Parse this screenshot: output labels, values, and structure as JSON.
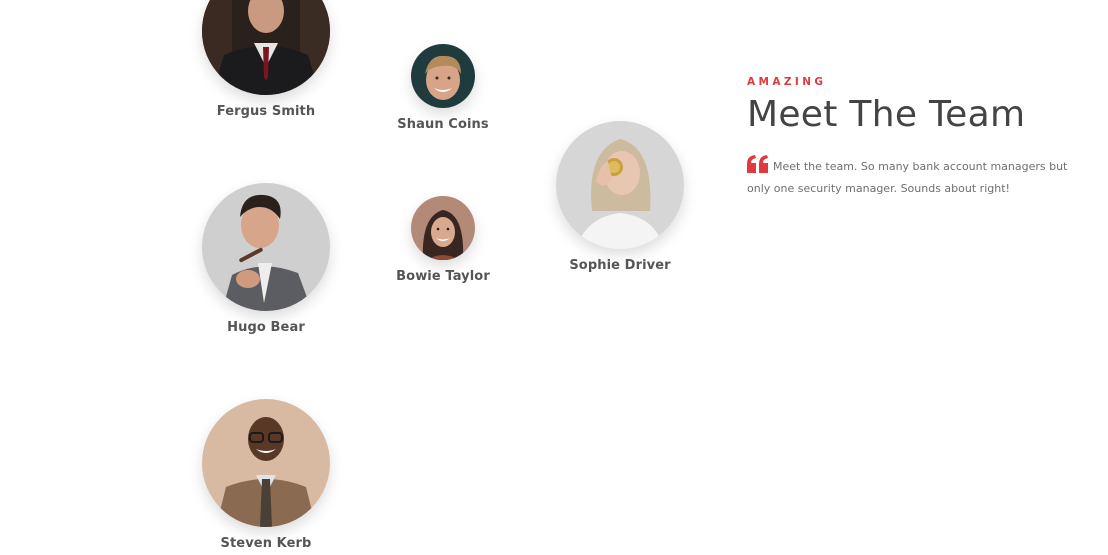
{
  "theme": {
    "accent": "#e0393e",
    "heading_color": "#444444",
    "text_color": "#6f6f6f"
  },
  "team": {
    "members": [
      {
        "name": "Fergus Smith"
      },
      {
        "name": "Shaun Coins"
      },
      {
        "name": "Hugo Bear"
      },
      {
        "name": "Bowie Taylor"
      },
      {
        "name": "Sophie Driver"
      },
      {
        "name": "Steven Kerb"
      }
    ]
  },
  "intro": {
    "eyebrow": "AMAZING",
    "title": "Meet The Team",
    "quote_icon": "quote-icon",
    "text": "Meet the team. So many bank account managers but only one security manager. Sounds about right!"
  }
}
